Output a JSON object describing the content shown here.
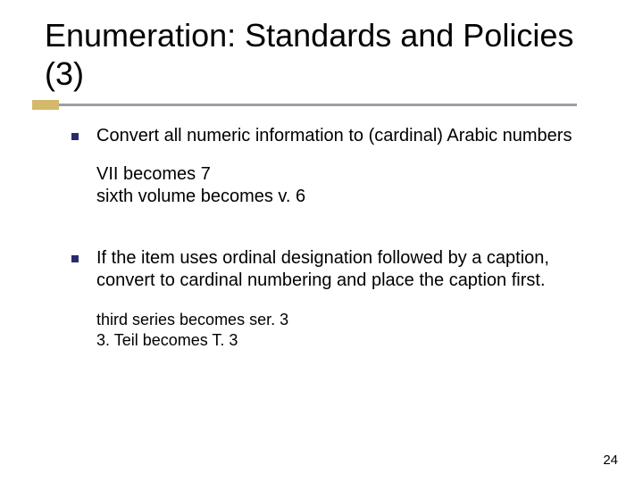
{
  "title": "Enumeration: Standards and Policies (3)",
  "bullets": [
    {
      "text": "Convert all numeric information to (cardinal) Arabic numbers",
      "examples": [
        "VII becomes 7",
        "sixth volume becomes v. 6"
      ],
      "example_size": "normal"
    },
    {
      "text": "If the item uses ordinal designation followed by a caption, convert to cardinal numbering and place the caption first.",
      "examples": [
        "third series becomes ser. 3",
        "3. Teil becomes T. 3"
      ],
      "example_size": "small"
    }
  ],
  "page_number": "24"
}
